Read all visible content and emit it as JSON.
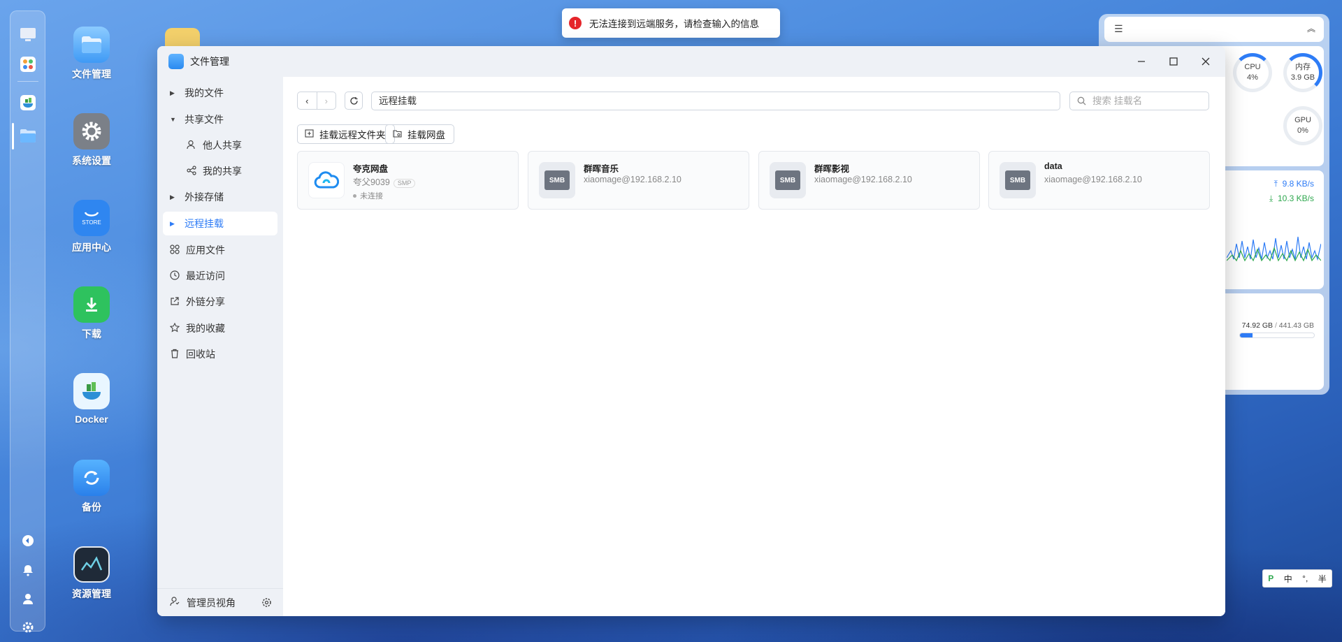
{
  "toast": {
    "message": "无法连接到远端服务，请检查输入的信息"
  },
  "desktop_icons": [
    {
      "label": "文件管理"
    },
    {
      "label": "系统设置"
    },
    {
      "label": "应用中心",
      "store_text": "STORE"
    },
    {
      "label": "下载"
    },
    {
      "label": "Docker"
    },
    {
      "label": "备份"
    },
    {
      "label": "资源管理"
    }
  ],
  "widgets": {
    "cpu": {
      "label": "CPU",
      "value": "4%",
      "percent": 4
    },
    "memory": {
      "label": "内存",
      "value": "3.9 GB"
    },
    "gpu": {
      "label": "GPU",
      "value": "0%"
    },
    "upload": "9.8 KB/s",
    "download": "10.3 KB/s",
    "storage": {
      "used": "74.92 GB",
      "sep": " / ",
      "total": "441.43 GB",
      "fraction": 0.17
    }
  },
  "window": {
    "title": "文件管理",
    "sidebar": [
      {
        "label": "我的文件",
        "type": "tree"
      },
      {
        "label": "共享文件",
        "type": "tree-open"
      },
      {
        "label": "他人共享",
        "type": "child"
      },
      {
        "label": "我的共享",
        "type": "child"
      },
      {
        "label": "外接存储",
        "type": "tree"
      },
      {
        "label": "远程挂载",
        "type": "tree",
        "active": true
      },
      {
        "label": "应用文件",
        "type": "icon"
      },
      {
        "label": "最近访问",
        "type": "icon"
      },
      {
        "label": "外链分享",
        "type": "icon"
      },
      {
        "label": "我的收藏",
        "type": "icon"
      },
      {
        "label": "回收站",
        "type": "icon"
      }
    ],
    "footer_label": "管理员视角",
    "path": "远程挂载",
    "search_placeholder": "搜索 挂载名",
    "toolbar": {
      "mount_remote_folder": "挂载远程文件夹",
      "mount_netdisk": "挂载网盘"
    },
    "cards": [
      {
        "name": "夸克网盘",
        "sub": "夸父9039",
        "badge": "SMP",
        "status": "未连接",
        "kind": "cloud"
      },
      {
        "name": "群晖音乐",
        "sub": "xiaomage@192.168.2.10",
        "kind": "smb",
        "icon_text": "SMB"
      },
      {
        "name": "群晖影视",
        "sub": "xiaomage@192.168.2.10",
        "kind": "smb",
        "icon_text": "SMB"
      },
      {
        "name": "data",
        "sub": "xiaomage@192.168.2.10",
        "kind": "smb",
        "icon_text": "SMB"
      }
    ]
  },
  "ime": {
    "logo": "P",
    "mode": "中",
    "punct": "°,",
    "width": "半"
  }
}
